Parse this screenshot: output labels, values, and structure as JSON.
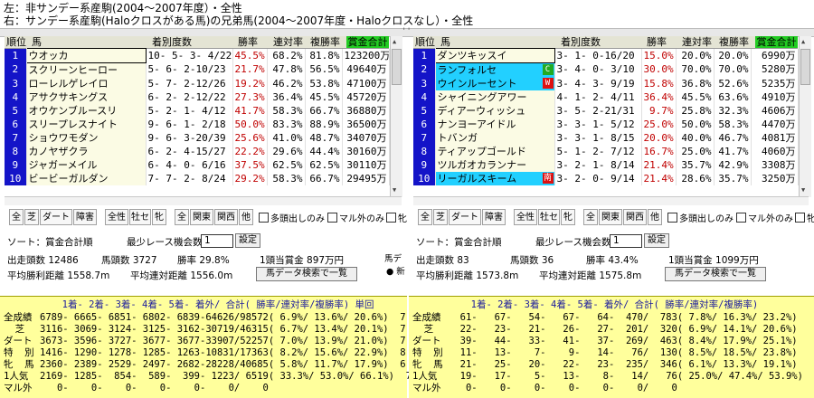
{
  "header": {
    "line1": "左：非サンデー系産駒(2004〜2007年度）・全性",
    "line2": "右：サンデー系産駒(Haloクロスがある馬)の兄弟馬(2004〜2007年度・Haloクロスなし）・全性"
  },
  "splitter_grip": "''",
  "columns": [
    "順位",
    "馬",
    "着別度数",
    "勝率",
    "連対率",
    "複勝率",
    "賞金合計"
  ],
  "left": {
    "rows": [
      {
        "rank": "1",
        "name": "ウオッカ",
        "record": "10- 5- 3- 4/22",
        "win": "45.5%",
        "place": "68.2%",
        "show": "81.8%",
        "prize": "123200万"
      },
      {
        "rank": "2",
        "name": "スクリーンヒーロー",
        "record": "5- 6- 2-10/23",
        "win": "21.7%",
        "place": "47.8%",
        "show": "56.5%",
        "prize": "49640万"
      },
      {
        "rank": "3",
        "name": "ローレルゲレイロ",
        "record": "5- 7- 2-12/26",
        "win": "19.2%",
        "place": "46.2%",
        "show": "53.8%",
        "prize": "47100万"
      },
      {
        "rank": "4",
        "name": "アサクサキングス",
        "record": "6- 2- 2-12/22",
        "win": "27.3%",
        "place": "36.4%",
        "show": "45.5%",
        "prize": "45720万"
      },
      {
        "rank": "5",
        "name": "オウケンブルースリ",
        "record": "5- 2- 1- 4/12",
        "win": "41.7%",
        "place": "58.3%",
        "show": "66.7%",
        "prize": "36880万"
      },
      {
        "rank": "6",
        "name": "スリープレスナイト",
        "record": "9- 6- 1- 2/18",
        "win": "50.0%",
        "place": "83.3%",
        "show": "88.9%",
        "prize": "36500万"
      },
      {
        "rank": "7",
        "name": "ショウワモダン",
        "record": "9- 6- 3-20/39",
        "win": "25.6%",
        "place": "41.0%",
        "show": "48.7%",
        "prize": "34070万"
      },
      {
        "rank": "8",
        "name": "カノヤザクラ",
        "record": "6- 2- 4-15/27",
        "win": "22.2%",
        "place": "29.6%",
        "show": "44.4%",
        "prize": "30160万"
      },
      {
        "rank": "9",
        "name": "ジャガーメイル",
        "record": "6- 4- 0- 6/16",
        "win": "37.5%",
        "place": "62.5%",
        "show": "62.5%",
        "prize": "30110万"
      },
      {
        "rank": "10",
        "name": "ビービーガルダン",
        "record": "7- 7- 2- 8/24",
        "win": "29.2%",
        "place": "58.3%",
        "show": "66.7%",
        "prize": "29495万"
      }
    ],
    "buttons": [
      "全",
      "芝",
      "ダート",
      "障害",
      "全性",
      "牡セ",
      "牝",
      "全",
      "関東",
      "関西",
      "他"
    ],
    "checks": [
      "多頭出しのみ",
      "マル外のみ",
      "牝"
    ],
    "sort_label": "ソート：賞金合計順",
    "min_races_label": "最少レース機会数",
    "min_races_value": "1",
    "set_label": "設定",
    "summary": {
      "starters": "出走頭数 12486",
      "horses": "馬頭数 3727",
      "win_rate": "勝率 29.8%",
      "avg_prize": "1頭当賞金 897万円",
      "avg_win_dist": "平均勝利距離 1558.7m",
      "avg_place_dist": "平均連対距離 1556.0m"
    },
    "search_button": "馬データ検索で一覧",
    "radio_title": "馬デ",
    "radio_option": "● 新"
  },
  "right": {
    "rows": [
      {
        "rank": "1",
        "name": "ダンツキッスイ",
        "record": "3- 1- 0-16/20",
        "win": "15.0%",
        "place": "20.0%",
        "show": "20.0%",
        "prize": "6990万",
        "mark": "",
        "mark_color": ""
      },
      {
        "rank": "2",
        "name": "ランフォルセ",
        "record": "3- 4- 0- 3/10",
        "win": "30.0%",
        "place": "70.0%",
        "show": "70.0%",
        "prize": "5280万",
        "mark": "C",
        "mark_color": "#22aa22"
      },
      {
        "rank": "3",
        "name": "ウインルーセント",
        "record": "3- 4- 3- 9/19",
        "win": "15.8%",
        "place": "36.8%",
        "show": "52.6%",
        "prize": "5235万",
        "mark": "W",
        "mark_color": "#dd1111"
      },
      {
        "rank": "4",
        "name": "シャイニングアワー",
        "record": "4- 1- 2- 4/11",
        "win": "36.4%",
        "place": "45.5%",
        "show": "63.6%",
        "prize": "4910万",
        "mark": "",
        "mark_color": ""
      },
      {
        "rank": "5",
        "name": "ディアーウィッシュ",
        "record": "3- 5- 2-21/31",
        "win": "9.7%",
        "place": "25.8%",
        "show": "32.3%",
        "prize": "4606万",
        "mark": "",
        "mark_color": ""
      },
      {
        "rank": "6",
        "name": "ナンヨーアイドル",
        "record": "3- 3- 1- 5/12",
        "win": "25.0%",
        "place": "50.0%",
        "show": "58.3%",
        "prize": "4470万",
        "mark": "",
        "mark_color": ""
      },
      {
        "rank": "7",
        "name": "トバンガ",
        "record": "3- 3- 1- 8/15",
        "win": "20.0%",
        "place": "40.0%",
        "show": "46.7%",
        "prize": "4081万",
        "mark": "",
        "mark_color": ""
      },
      {
        "rank": "8",
        "name": "ティアップゴールド",
        "record": "5- 1- 2- 7/12",
        "win": "16.7%",
        "place": "25.0%",
        "show": "41.7%",
        "prize": "4060万",
        "mark": "",
        "mark_color": ""
      },
      {
        "rank": "9",
        "name": "ツルガオカランナー",
        "record": "3- 2- 1- 8/14",
        "win": "21.4%",
        "place": "35.7%",
        "show": "42.9%",
        "prize": "3308万",
        "mark": "",
        "mark_color": ""
      },
      {
        "rank": "10",
        "name": "リーガルスキーム",
        "record": "3- 2- 0- 9/14",
        "win": "21.4%",
        "place": "28.6%",
        "show": "35.7%",
        "prize": "3250万",
        "mark": "南",
        "mark_color": "#dd1111"
      }
    ],
    "buttons": [
      "全",
      "芝",
      "ダート",
      "障害",
      "全性",
      "牡セ",
      "牝",
      "全",
      "関東",
      "関西",
      "他"
    ],
    "checks": [
      "多頭出しのみ",
      "マル外のみ",
      "牝"
    ],
    "sort_label": "ソート：賞金合計順",
    "min_races_label": "最少レース機会数",
    "min_races_value": "1",
    "set_label": "設定",
    "summary": {
      "starters": "出走頭数 83",
      "horses": "馬頭数 36",
      "win_rate": "勝率 43.4%",
      "avg_prize": "1頭当賞金 1099万円",
      "avg_win_dist": "平均勝利距離 1573.8m",
      "avg_place_dist": "平均連対距離 1575.8m"
    },
    "search_button": "馬データ検索で一覧"
  },
  "stats_left": {
    "header": "  1着- 2着- 3着- 4着- 5着- 着外/ 合計( 勝率/連対率/複勝率) 単回",
    "rows": [
      {
        "label": "全成績",
        "text": "6789- 6665- 6851- 6802- 6839-64626/98572( 6.9%/ 13.6%/ 20.6%)  7"
      },
      {
        "label": "  芝  ",
        "text": "3116- 3069- 3124- 3125- 3162-30719/46315( 6.7%/ 13.4%/ 20.1%)  7"
      },
      {
        "label": "ダート",
        "text": "3673- 3596- 3727- 3677- 3677-33907/52257( 7.0%/ 13.9%/ 21.0%)  7"
      },
      {
        "label": "特  別",
        "text": "1416- 1290- 1278- 1285- 1263-10831/17363( 8.2%/ 15.6%/ 22.9%)  8"
      },
      {
        "label": "牝  馬",
        "text": "2360- 2389- 2529- 2497- 2682-28228/40685( 5.8%/ 11.7%/ 17.9%)  6"
      },
      {
        "label": "1人気",
        "text": "2169- 1285-  854-  589-  399- 1223/ 6519( 33.3%/ 53.0%/ 66.1%)  7"
      },
      {
        "label": "マル外",
        "text": "   0-    0-    0-    0-    0-    0/    0"
      }
    ]
  },
  "stats_right": {
    "header": "  1着- 2着- 3着- 4着- 5着- 着外/ 合計( 勝率/連対率/複勝率)",
    "rows": [
      {
        "label": "全成績",
        "text": "  61-   67-   54-   67-   64-  470/  783( 7.8%/ 16.3%/ 23.2%)"
      },
      {
        "label": "  芝  ",
        "text": "  22-   23-   21-   26-   27-  201/  320( 6.9%/ 14.1%/ 20.6%)"
      },
      {
        "label": "ダート",
        "text": "  39-   44-   33-   41-   37-  269/  463( 8.4%/ 17.9%/ 25.1%)"
      },
      {
        "label": "特  別",
        "text": "  11-   13-    7-    9-   14-   76/  130( 8.5%/ 18.5%/ 23.8%)"
      },
      {
        "label": "牝  馬",
        "text": "  21-   25-   20-   22-   23-  235/  346( 6.1%/ 13.3%/ 19.1%)"
      },
      {
        "label": "1人気",
        "text": "  19-   17-    5-   13-    8-   14/   76( 25.0%/ 47.4%/ 53.9%)"
      },
      {
        "label": "マル外",
        "text": "   0-    0-    0-    0-    0-    0/    0"
      }
    ]
  }
}
